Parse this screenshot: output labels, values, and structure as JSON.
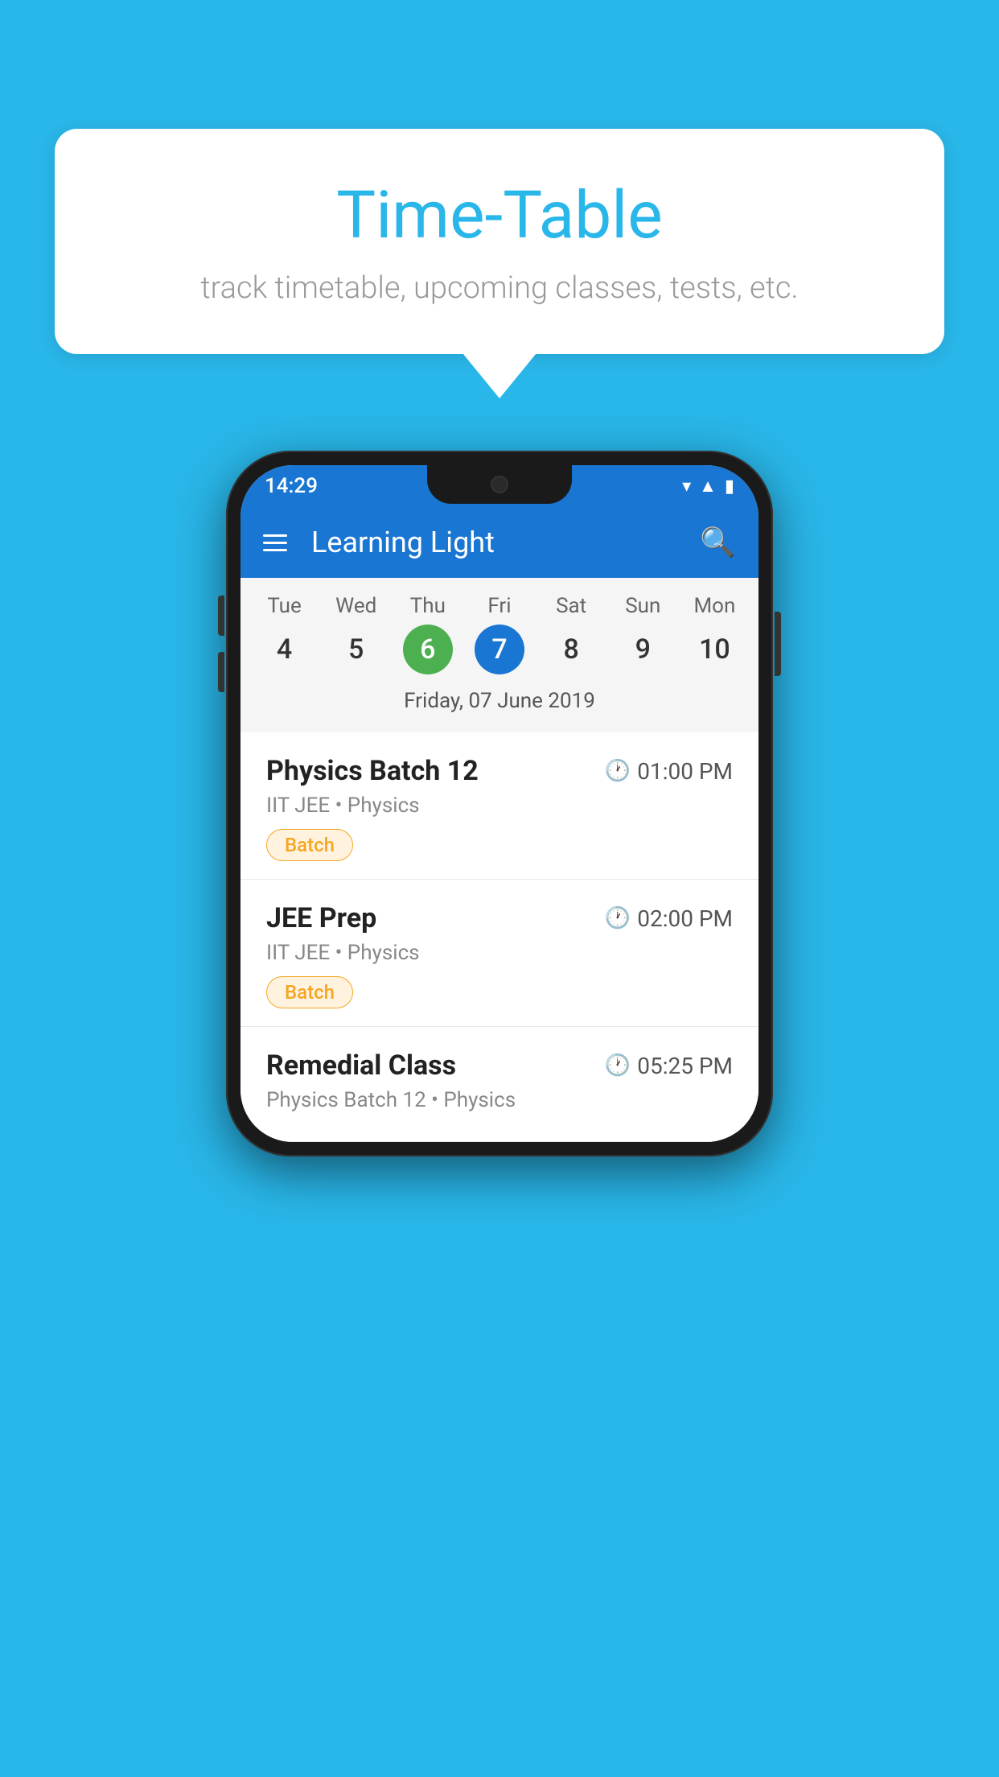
{
  "background_color": "#29b6e8",
  "speech_bubble": {
    "title": "Time-Table",
    "subtitle": "track timetable, upcoming classes, tests, etc."
  },
  "phone": {
    "status_bar": {
      "time": "14:29"
    },
    "app_bar": {
      "title": "Learning Light"
    },
    "calendar": {
      "days": [
        {
          "name": "Tue",
          "num": "4",
          "state": "normal"
        },
        {
          "name": "Wed",
          "num": "5",
          "state": "normal"
        },
        {
          "name": "Thu",
          "num": "6",
          "state": "today"
        },
        {
          "name": "Fri",
          "num": "7",
          "state": "selected"
        },
        {
          "name": "Sat",
          "num": "8",
          "state": "normal"
        },
        {
          "name": "Sun",
          "num": "9",
          "state": "normal"
        },
        {
          "name": "Mon",
          "num": "10",
          "state": "normal"
        }
      ],
      "selected_date_label": "Friday, 07 June 2019"
    },
    "schedule": [
      {
        "title": "Physics Batch 12",
        "time": "01:00 PM",
        "subtitle": "IIT JEE • Physics",
        "badge": "Batch"
      },
      {
        "title": "JEE Prep",
        "time": "02:00 PM",
        "subtitle": "IIT JEE • Physics",
        "badge": "Batch"
      },
      {
        "title": "Remedial Class",
        "time": "05:25 PM",
        "subtitle": "Physics Batch 12 • Physics",
        "badge": null
      }
    ]
  }
}
